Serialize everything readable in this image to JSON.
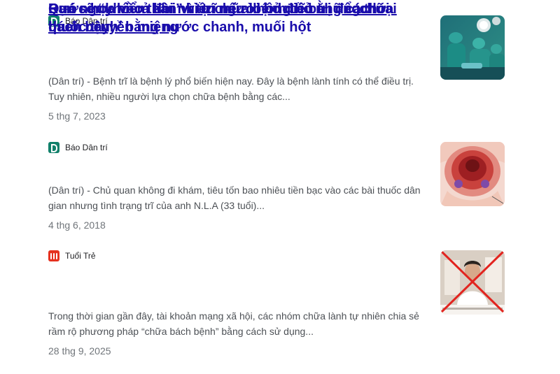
{
  "results": [
    {
      "source": "Báo Dân trí",
      "favicon": "dan-tri-logo-icon",
      "title": "Rước họa vào thân vì tự chữa bệnh trĩ bằng các loại thuốc truyền miệng",
      "snippet": "(Dân trí) - Bệnh trĩ là bệnh lý phổ biến hiện nay. Đây là bệnh lành tính có thể điều trị. Tuy nhiên, nhiều người lựa chọn chữa bệnh bằng các...",
      "date": "5 thg 7, 2023",
      "thumbnail": "surgery-photo"
    },
    {
      "source": "Báo Dân trí",
      "favicon": "dan-tri-logo-icon",
      "title": "Bạn sẽ “khổ cả đời” vì trĩ nếu không bỏ những thói quen này",
      "snippet": "(Dân trí) - Chủ quan không đi khám, tiêu tốn bao nhiêu tiền bạc vào các bài thuốc dân gian nhưng tình trạng trĩ của anh N.L.A (33 tuổi)...",
      "date": "4 thg 6, 2018",
      "thumbnail": "hemorrhoid-illustration"
    },
    {
      "source": "Tuổi Trẻ",
      "favicon": "tuoi-tre-logo-icon",
      "title": "Quá nguy hiểm khi nhiều người bỏ điều trị để ‘chữa bách bệnh’ bằng nước chanh, muối hột",
      "snippet": "Trong thời gian gần đây, tài khoản mạng xã hội, các nhóm chữa lành tự nhiên chia sẻ rầm rộ phương pháp “chữa bách bệnh” bằng cách sử dụng...",
      "date": "28 thg 9, 2025",
      "thumbnail": "crossed-out-video-screenshot"
    }
  ],
  "colors": {
    "link": "#1a0dab",
    "snippet": "#4d5156",
    "date": "#70757a",
    "dan_tri": "#10806a",
    "tuoi_tre": "#e5311f"
  }
}
